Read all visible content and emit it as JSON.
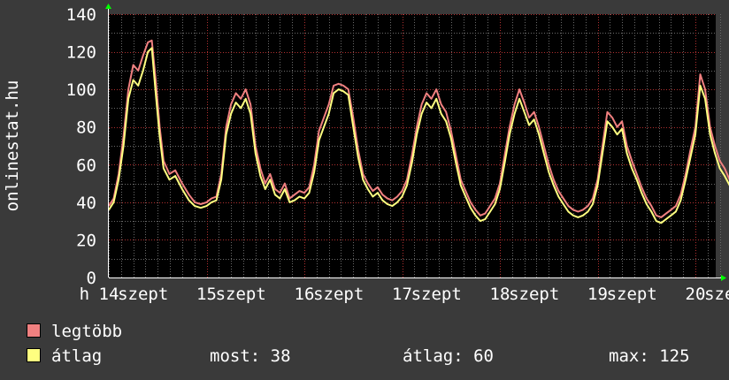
{
  "chart_data": {
    "type": "line",
    "ylabel": "onlinestat.hu",
    "ylim": [
      0,
      140
    ],
    "yticks": [
      0,
      20,
      40,
      60,
      80,
      100,
      120,
      140
    ],
    "xlim": [
      0,
      7.3
    ],
    "xtick_labels": [
      {
        "x": -0.25,
        "label": "h"
      },
      {
        "x": 0.0,
        "label": "14"
      },
      {
        "x": 0.35,
        "label": "szept"
      },
      {
        "x": 1.0,
        "label": "15"
      },
      {
        "x": 1.35,
        "label": "szept"
      },
      {
        "x": 2.0,
        "label": "16"
      },
      {
        "x": 2.35,
        "label": "szept"
      },
      {
        "x": 3.0,
        "label": "17"
      },
      {
        "x": 3.35,
        "label": "szept"
      },
      {
        "x": 4.0,
        "label": "18"
      },
      {
        "x": 4.35,
        "label": "szept"
      },
      {
        "x": 5.0,
        "label": "19"
      },
      {
        "x": 5.35,
        "label": "szept"
      },
      {
        "x": 6.0,
        "label": "20"
      },
      {
        "x": 6.35,
        "label": "szept"
      }
    ],
    "grid": true,
    "colors": {
      "legtobb": "#f08080",
      "atlag": "#ffff80",
      "grid_major": "#b03030",
      "grid_minor": "#6a6a6a",
      "axis": "#ffffff",
      "arrow": "#00ff00"
    },
    "series": [
      {
        "name": "legtöbb",
        "color": "#f08080",
        "points": [
          [
            0.0,
            38
          ],
          [
            0.05,
            42
          ],
          [
            0.1,
            55
          ],
          [
            0.15,
            75
          ],
          [
            0.2,
            100
          ],
          [
            0.25,
            113
          ],
          [
            0.3,
            110
          ],
          [
            0.35,
            118
          ],
          [
            0.4,
            125
          ],
          [
            0.44,
            126
          ],
          [
            0.48,
            105
          ],
          [
            0.52,
            80
          ],
          [
            0.56,
            62
          ],
          [
            0.62,
            55
          ],
          [
            0.68,
            57
          ],
          [
            0.75,
            50
          ],
          [
            0.82,
            44
          ],
          [
            0.88,
            40
          ],
          [
            0.94,
            39
          ],
          [
            1.0,
            40
          ],
          [
            1.05,
            42
          ],
          [
            1.1,
            43
          ],
          [
            1.15,
            55
          ],
          [
            1.2,
            80
          ],
          [
            1.25,
            92
          ],
          [
            1.3,
            98
          ],
          [
            1.35,
            95
          ],
          [
            1.4,
            100
          ],
          [
            1.45,
            92
          ],
          [
            1.5,
            70
          ],
          [
            1.55,
            58
          ],
          [
            1.6,
            50
          ],
          [
            1.65,
            55
          ],
          [
            1.7,
            47
          ],
          [
            1.75,
            45
          ],
          [
            1.8,
            50
          ],
          [
            1.85,
            42
          ],
          [
            1.9,
            44
          ],
          [
            1.95,
            46
          ],
          [
            2.0,
            45
          ],
          [
            2.05,
            48
          ],
          [
            2.1,
            60
          ],
          [
            2.15,
            78
          ],
          [
            2.2,
            85
          ],
          [
            2.25,
            92
          ],
          [
            2.3,
            102
          ],
          [
            2.35,
            103
          ],
          [
            2.4,
            102
          ],
          [
            2.45,
            100
          ],
          [
            2.5,
            85
          ],
          [
            2.55,
            68
          ],
          [
            2.6,
            55
          ],
          [
            2.65,
            50
          ],
          [
            2.7,
            46
          ],
          [
            2.75,
            48
          ],
          [
            2.8,
            44
          ],
          [
            2.85,
            42
          ],
          [
            2.9,
            41
          ],
          [
            2.95,
            43
          ],
          [
            3.0,
            46
          ],
          [
            3.05,
            52
          ],
          [
            3.1,
            65
          ],
          [
            3.15,
            80
          ],
          [
            3.2,
            92
          ],
          [
            3.25,
            98
          ],
          [
            3.3,
            95
          ],
          [
            3.35,
            100
          ],
          [
            3.4,
            92
          ],
          [
            3.45,
            88
          ],
          [
            3.5,
            78
          ],
          [
            3.55,
            65
          ],
          [
            3.6,
            52
          ],
          [
            3.65,
            46
          ],
          [
            3.7,
            40
          ],
          [
            3.75,
            36
          ],
          [
            3.8,
            33
          ],
          [
            3.85,
            34
          ],
          [
            3.9,
            38
          ],
          [
            3.95,
            42
          ],
          [
            4.0,
            50
          ],
          [
            4.05,
            65
          ],
          [
            4.1,
            80
          ],
          [
            4.15,
            92
          ],
          [
            4.2,
            100
          ],
          [
            4.25,
            93
          ],
          [
            4.3,
            85
          ],
          [
            4.35,
            88
          ],
          [
            4.4,
            80
          ],
          [
            4.45,
            70
          ],
          [
            4.5,
            60
          ],
          [
            4.55,
            52
          ],
          [
            4.6,
            46
          ],
          [
            4.65,
            42
          ],
          [
            4.7,
            38
          ],
          [
            4.75,
            36
          ],
          [
            4.8,
            35
          ],
          [
            4.85,
            36
          ],
          [
            4.9,
            38
          ],
          [
            4.95,
            42
          ],
          [
            5.0,
            52
          ],
          [
            5.05,
            70
          ],
          [
            5.1,
            88
          ],
          [
            5.15,
            85
          ],
          [
            5.2,
            80
          ],
          [
            5.25,
            83
          ],
          [
            5.3,
            70
          ],
          [
            5.35,
            62
          ],
          [
            5.4,
            55
          ],
          [
            5.45,
            48
          ],
          [
            5.5,
            42
          ],
          [
            5.55,
            38
          ],
          [
            5.6,
            33
          ],
          [
            5.65,
            32
          ],
          [
            5.7,
            34
          ],
          [
            5.75,
            36
          ],
          [
            5.8,
            38
          ],
          [
            5.85,
            44
          ],
          [
            5.9,
            55
          ],
          [
            5.95,
            68
          ],
          [
            6.0,
            80
          ],
          [
            6.05,
            108
          ],
          [
            6.1,
            100
          ],
          [
            6.15,
            80
          ],
          [
            6.2,
            70
          ],
          [
            6.25,
            62
          ],
          [
            6.3,
            58
          ],
          [
            6.35,
            52
          ],
          [
            6.4,
            48
          ],
          [
            6.45,
            44
          ],
          [
            6.5,
            38
          ],
          [
            6.55,
            36
          ],
          [
            6.6,
            34
          ],
          [
            6.65,
            33
          ],
          [
            6.7,
            30
          ],
          [
            6.75,
            33
          ],
          [
            6.8,
            36
          ],
          [
            6.85,
            40
          ],
          [
            6.9,
            42
          ],
          [
            6.95,
            41
          ],
          [
            7.0,
            43
          ],
          [
            7.05,
            40
          ],
          [
            7.1,
            35
          ],
          [
            7.15,
            38
          ],
          [
            7.2,
            40
          ],
          [
            7.25,
            42
          ]
        ]
      },
      {
        "name": "átlag",
        "color": "#ffff80",
        "points": [
          [
            0.0,
            36
          ],
          [
            0.05,
            40
          ],
          [
            0.1,
            52
          ],
          [
            0.15,
            70
          ],
          [
            0.2,
            95
          ],
          [
            0.25,
            105
          ],
          [
            0.3,
            102
          ],
          [
            0.35,
            110
          ],
          [
            0.4,
            120
          ],
          [
            0.44,
            122
          ],
          [
            0.48,
            98
          ],
          [
            0.52,
            75
          ],
          [
            0.56,
            58
          ],
          [
            0.62,
            52
          ],
          [
            0.68,
            54
          ],
          [
            0.75,
            47
          ],
          [
            0.82,
            41
          ],
          [
            0.88,
            38
          ],
          [
            0.94,
            37
          ],
          [
            1.0,
            38
          ],
          [
            1.05,
            40
          ],
          [
            1.1,
            41
          ],
          [
            1.15,
            52
          ],
          [
            1.2,
            76
          ],
          [
            1.25,
            87
          ],
          [
            1.3,
            93
          ],
          [
            1.35,
            90
          ],
          [
            1.4,
            95
          ],
          [
            1.45,
            87
          ],
          [
            1.5,
            66
          ],
          [
            1.55,
            54
          ],
          [
            1.6,
            47
          ],
          [
            1.65,
            52
          ],
          [
            1.7,
            44
          ],
          [
            1.75,
            42
          ],
          [
            1.8,
            47
          ],
          [
            1.85,
            40
          ],
          [
            1.9,
            41
          ],
          [
            1.95,
            43
          ],
          [
            2.0,
            42
          ],
          [
            2.05,
            45
          ],
          [
            2.1,
            56
          ],
          [
            2.15,
            73
          ],
          [
            2.2,
            80
          ],
          [
            2.25,
            87
          ],
          [
            2.3,
            98
          ],
          [
            2.35,
            100
          ],
          [
            2.4,
            99
          ],
          [
            2.45,
            97
          ],
          [
            2.5,
            80
          ],
          [
            2.55,
            64
          ],
          [
            2.6,
            52
          ],
          [
            2.65,
            47
          ],
          [
            2.7,
            43
          ],
          [
            2.75,
            45
          ],
          [
            2.8,
            41
          ],
          [
            2.85,
            39
          ],
          [
            2.9,
            38
          ],
          [
            2.95,
            40
          ],
          [
            3.0,
            43
          ],
          [
            3.05,
            49
          ],
          [
            3.1,
            61
          ],
          [
            3.15,
            76
          ],
          [
            3.2,
            87
          ],
          [
            3.25,
            93
          ],
          [
            3.3,
            90
          ],
          [
            3.35,
            95
          ],
          [
            3.4,
            87
          ],
          [
            3.45,
            83
          ],
          [
            3.5,
            74
          ],
          [
            3.55,
            61
          ],
          [
            3.6,
            49
          ],
          [
            3.65,
            43
          ],
          [
            3.7,
            37
          ],
          [
            3.75,
            33
          ],
          [
            3.8,
            30
          ],
          [
            3.85,
            31
          ],
          [
            3.9,
            35
          ],
          [
            3.95,
            39
          ],
          [
            4.0,
            47
          ],
          [
            4.05,
            61
          ],
          [
            4.1,
            76
          ],
          [
            4.15,
            87
          ],
          [
            4.2,
            95
          ],
          [
            4.25,
            88
          ],
          [
            4.3,
            81
          ],
          [
            4.35,
            84
          ],
          [
            4.4,
            76
          ],
          [
            4.45,
            66
          ],
          [
            4.5,
            56
          ],
          [
            4.55,
            49
          ],
          [
            4.6,
            43
          ],
          [
            4.65,
            39
          ],
          [
            4.7,
            35
          ],
          [
            4.75,
            33
          ],
          [
            4.8,
            32
          ],
          [
            4.85,
            33
          ],
          [
            4.9,
            35
          ],
          [
            4.95,
            39
          ],
          [
            5.0,
            49
          ],
          [
            5.05,
            66
          ],
          [
            5.1,
            83
          ],
          [
            5.15,
            80
          ],
          [
            5.2,
            76
          ],
          [
            5.25,
            79
          ],
          [
            5.3,
            66
          ],
          [
            5.35,
            58
          ],
          [
            5.4,
            52
          ],
          [
            5.45,
            45
          ],
          [
            5.5,
            39
          ],
          [
            5.55,
            35
          ],
          [
            5.6,
            30
          ],
          [
            5.65,
            29
          ],
          [
            5.7,
            31
          ],
          [
            5.75,
            33
          ],
          [
            5.8,
            35
          ],
          [
            5.85,
            41
          ],
          [
            5.9,
            52
          ],
          [
            5.95,
            64
          ],
          [
            6.0,
            76
          ],
          [
            6.05,
            102
          ],
          [
            6.1,
            95
          ],
          [
            6.15,
            76
          ],
          [
            6.2,
            66
          ],
          [
            6.25,
            58
          ],
          [
            6.3,
            54
          ],
          [
            6.35,
            49
          ],
          [
            6.4,
            45
          ],
          [
            6.45,
            41
          ],
          [
            6.5,
            35
          ],
          [
            6.55,
            33
          ],
          [
            6.6,
            31
          ],
          [
            6.65,
            30
          ],
          [
            6.7,
            28
          ],
          [
            6.75,
            30
          ],
          [
            6.8,
            33
          ],
          [
            6.85,
            37
          ],
          [
            6.9,
            39
          ],
          [
            6.95,
            38
          ],
          [
            7.0,
            40
          ],
          [
            7.05,
            37
          ],
          [
            7.1,
            32
          ],
          [
            7.15,
            35
          ],
          [
            7.2,
            37
          ],
          [
            7.25,
            38
          ]
        ]
      }
    ]
  },
  "legend": [
    {
      "label": "legtöbb",
      "color": "#f08080"
    },
    {
      "label": "átlag",
      "color": "#ffff80"
    }
  ],
  "stats": {
    "most": "most: 38",
    "atlag": "átlag: 60",
    "max": "max: 125"
  }
}
